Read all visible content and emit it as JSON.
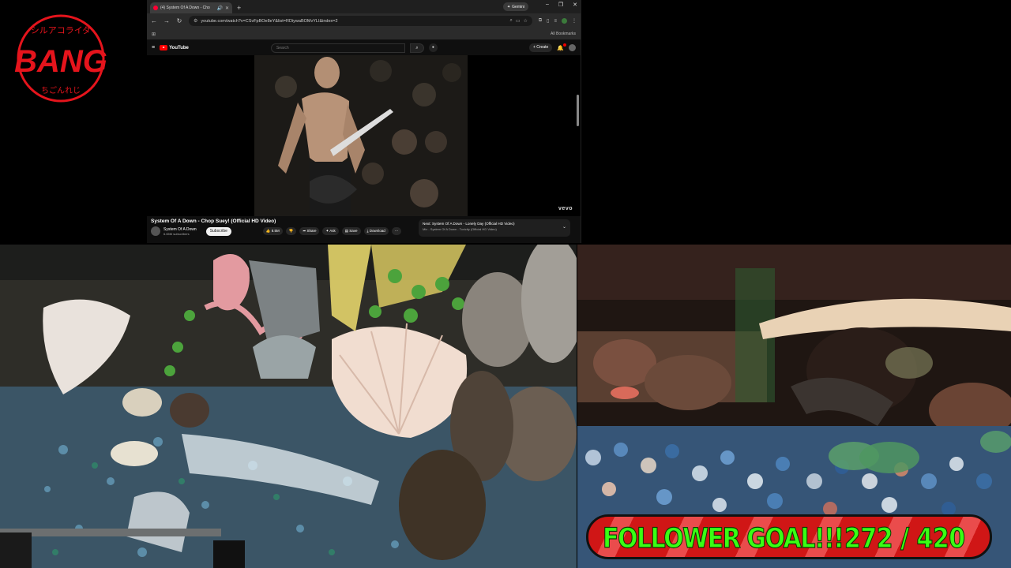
{
  "logo": {
    "text": "BANG",
    "ring_text_top": "シルアコライダ",
    "ring_text_bottom": "ちごんれじ",
    "color": "#e5141c"
  },
  "browser": {
    "tab_title": "(4) System Of A Down - Cho",
    "gemini_label": "Gemini",
    "url": "youtube.com/watch?v=CSvFpBOe8eY&list=RDiywaBOMvYLI&index=2",
    "bookmarks_label": "All Bookmarks"
  },
  "youtube": {
    "logo_text": "YouTube",
    "search_placeholder": "Search",
    "create_label": "Create",
    "video_watermark": "vevo",
    "video_title": "System Of A Down - Chop Suey! (Official HD Video)",
    "channel_name": "System Of A Down",
    "channel_subs": "6.65M subscribers",
    "subscribe_label": "Subscribe",
    "like_count": "8.5M",
    "share_label": "Share",
    "ask_label": "Ask",
    "save_label": "Save",
    "download_label": "Download",
    "next_title": "Next: System Of A Down - Lonely Day (Official HD Video)",
    "next_sub": "Mix - System Of A Down - Toxicity (Official HD Video)"
  },
  "goal": {
    "label": "FOLLOWER GOAL!!!",
    "current": 272,
    "target": 420,
    "count_text": "272 / 420",
    "bar_color": "#d01616",
    "text_color": "#39ff14"
  }
}
